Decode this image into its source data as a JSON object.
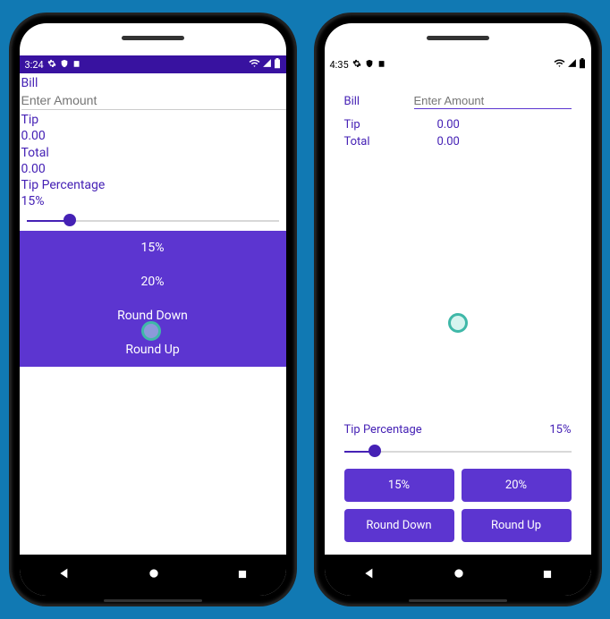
{
  "phoneA": {
    "status_time": "3:24",
    "bill_label": "Bill",
    "bill_placeholder": "Enter Amount",
    "tip_label": "Tip",
    "tip_value": "0.00",
    "total_label": "Total",
    "total_value": "0.00",
    "tip_pct_label": "Tip Percentage",
    "tip_pct_value": "15%",
    "buttons": {
      "b15": "15%",
      "b20": "20%",
      "round_down": "Round Down",
      "round_up": "Round Up"
    }
  },
  "phoneB": {
    "status_time": "4:35",
    "bill_label": "Bill",
    "bill_placeholder": "Enter Amount",
    "tip_label": "Tip",
    "tip_value": "0.00",
    "total_label": "Total",
    "total_value": "0.00",
    "tip_pct_label": "Tip Percentage",
    "tip_pct_value": "15%",
    "buttons": {
      "b15": "15%",
      "b20": "20%",
      "round_down": "Round Down",
      "round_up": "Round Up"
    }
  }
}
